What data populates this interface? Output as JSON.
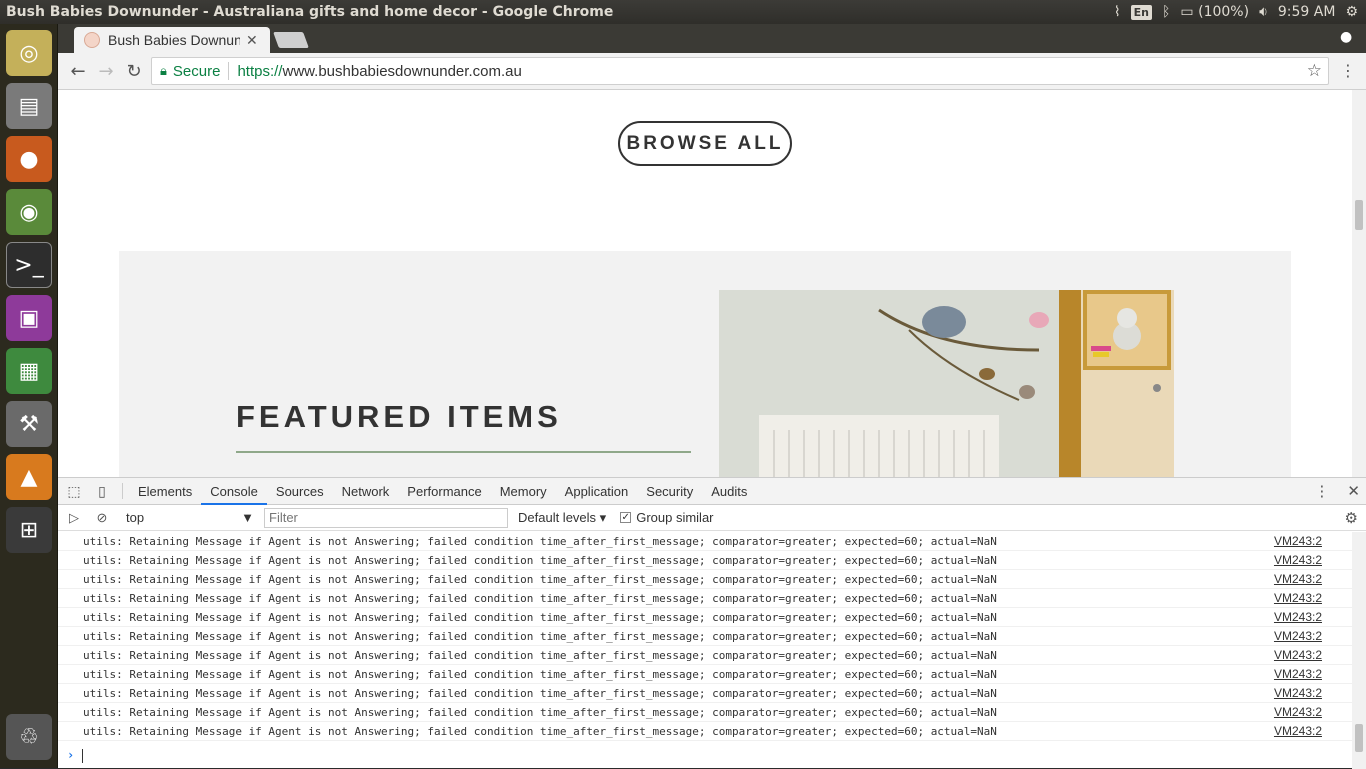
{
  "window": {
    "title": "Bush Babies Downunder - Australiana gifts and home decor - Google Chrome"
  },
  "tray": {
    "keyboard": "En",
    "battery": "(100%)",
    "time": "9:59 AM"
  },
  "launcher": [
    "ubuntu-dash",
    "files",
    "firefox",
    "chrome",
    "terminal",
    "app-5",
    "spreadsheet",
    "settings",
    "vlc",
    "workspaces",
    "trash"
  ],
  "tab": {
    "title": "Bush Babies Downunder"
  },
  "omnibox": {
    "secure_label": "Secure",
    "scheme": "https://",
    "host": "www.bushbabiesdownunder.com.au"
  },
  "page": {
    "browse_all": "BROWSE ALL",
    "featured_title": "FEATURED ITEMS"
  },
  "devtools": {
    "tabs": [
      "Elements",
      "Console",
      "Sources",
      "Network",
      "Performance",
      "Memory",
      "Application",
      "Security",
      "Audits"
    ],
    "active_tab": "Console",
    "context": "top",
    "filter_placeholder": "Filter",
    "levels": "Default levels",
    "group_similar": "Group similar",
    "messages": [
      {
        "text": "utils: Retaining Message if Agent is not Answering; failed condition time_after_first_message; comparator=greater; expected=60; actual=NaN",
        "source": "VM243:2"
      },
      {
        "text": "utils: Retaining Message if Agent is not Answering; failed condition time_after_first_message; comparator=greater; expected=60; actual=NaN",
        "source": "VM243:2"
      },
      {
        "text": "utils: Retaining Message if Agent is not Answering; failed condition time_after_first_message; comparator=greater; expected=60; actual=NaN",
        "source": "VM243:2"
      },
      {
        "text": "utils: Retaining Message if Agent is not Answering; failed condition time_after_first_message; comparator=greater; expected=60; actual=NaN",
        "source": "VM243:2"
      },
      {
        "text": "utils: Retaining Message if Agent is not Answering; failed condition time_after_first_message; comparator=greater; expected=60; actual=NaN",
        "source": "VM243:2"
      },
      {
        "text": "utils: Retaining Message if Agent is not Answering; failed condition time_after_first_message; comparator=greater; expected=60; actual=NaN",
        "source": "VM243:2"
      },
      {
        "text": "utils: Retaining Message if Agent is not Answering; failed condition time_after_first_message; comparator=greater; expected=60; actual=NaN",
        "source": "VM243:2"
      },
      {
        "text": "utils: Retaining Message if Agent is not Answering; failed condition time_after_first_message; comparator=greater; expected=60; actual=NaN",
        "source": "VM243:2"
      },
      {
        "text": "utils: Retaining Message if Agent is not Answering; failed condition time_after_first_message; comparator=greater; expected=60; actual=NaN",
        "source": "VM243:2"
      },
      {
        "text": "utils: Retaining Message if Agent is not Answering; failed condition time_after_first_message; comparator=greater; expected=60; actual=NaN",
        "source": "VM243:2"
      },
      {
        "text": "utils: Retaining Message if Agent is not Answering; failed condition time_after_first_message; comparator=greater; expected=60; actual=NaN",
        "source": "VM243:2"
      }
    ]
  }
}
